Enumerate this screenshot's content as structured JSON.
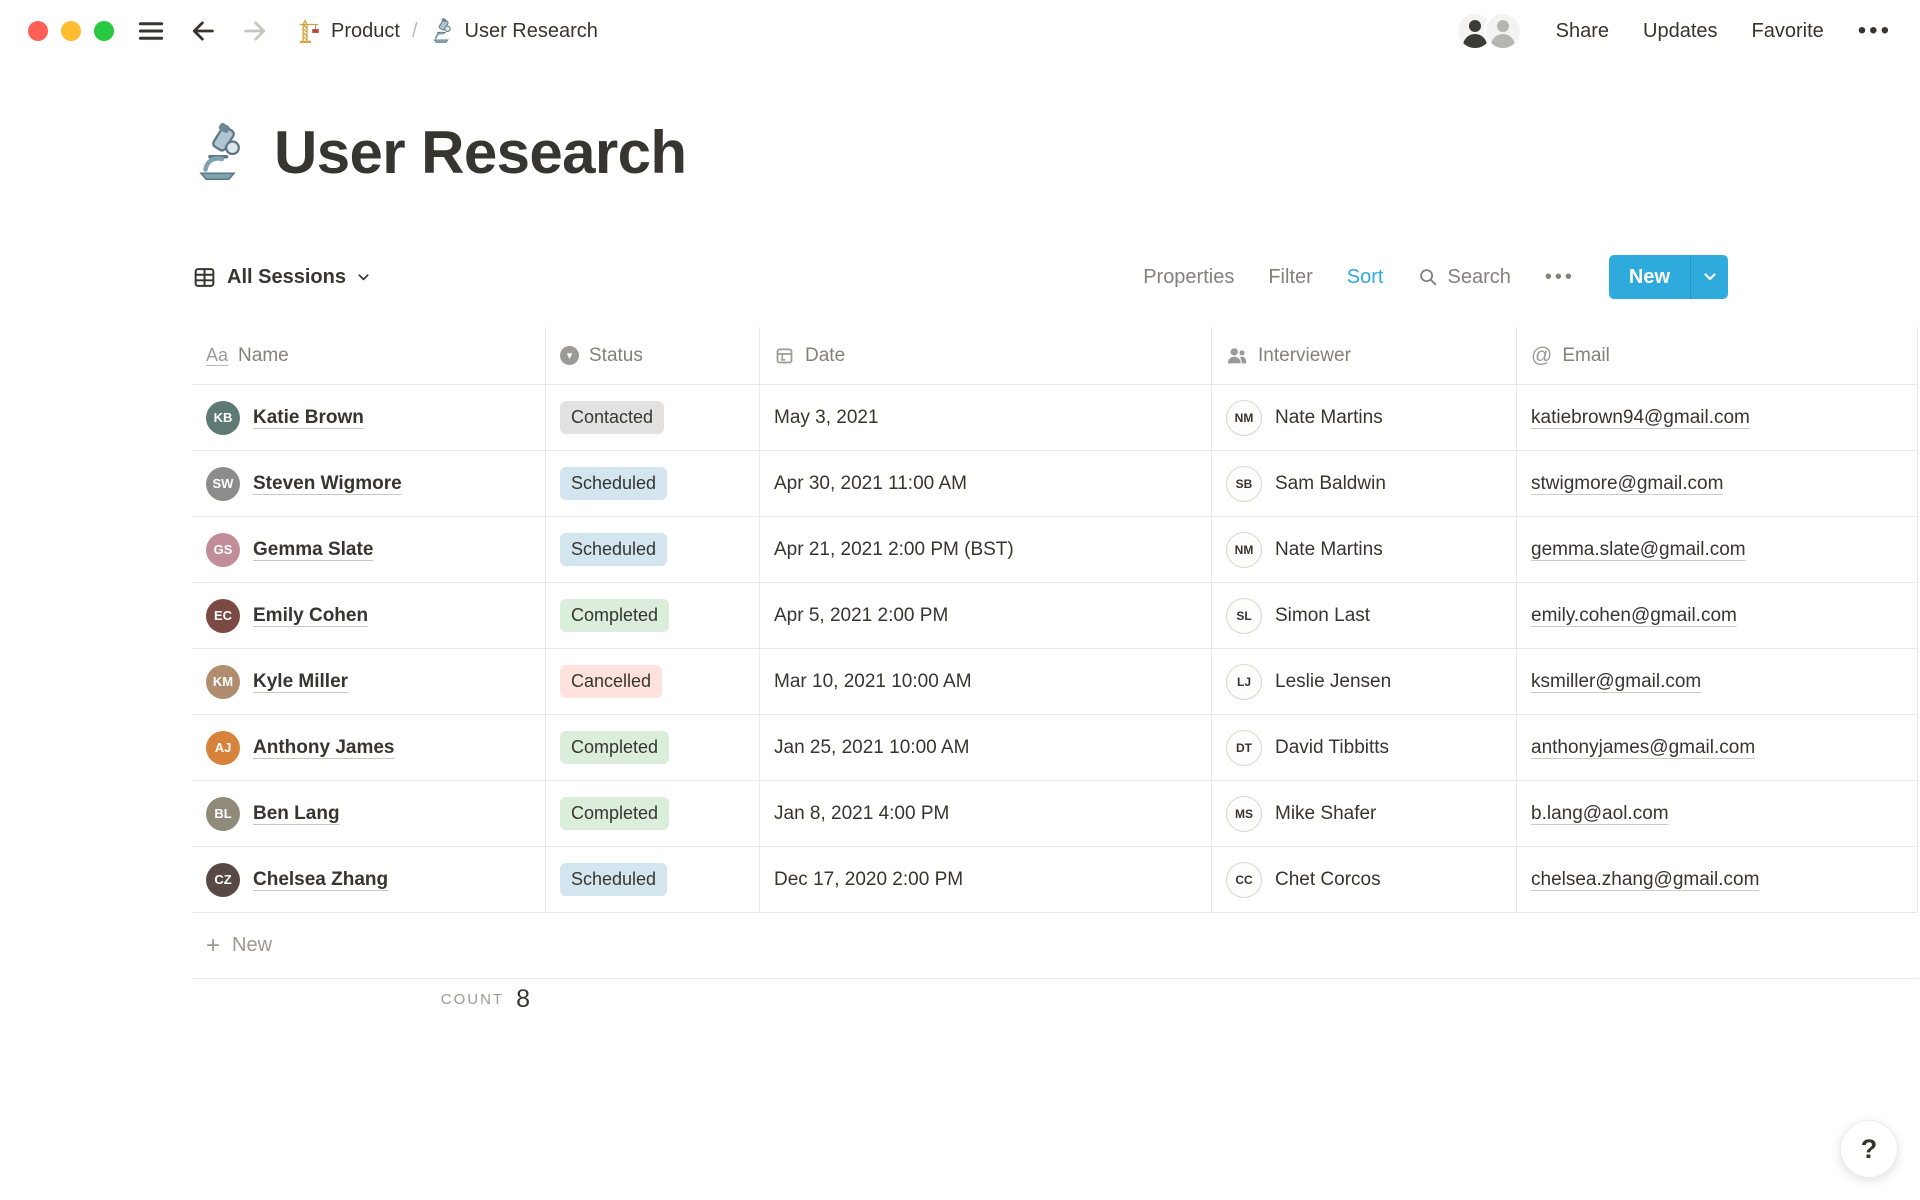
{
  "topbar": {
    "breadcrumb": {
      "root_icon": "building-construction-crane",
      "root_label": "Product",
      "separator": "/",
      "page_icon": "microscope",
      "page_label": "User Research"
    },
    "collaborators_count": 2,
    "share_label": "Share",
    "updates_label": "Updates",
    "favorite_label": "Favorite",
    "more_glyph": "•••"
  },
  "title": {
    "icon": "microscope",
    "text": "User Research"
  },
  "toolbar": {
    "view_label": "All Sessions",
    "properties_label": "Properties",
    "filter_label": "Filter",
    "sort_label": "Sort",
    "search_label": "Search",
    "more_glyph": "•••",
    "new_label": "New"
  },
  "table": {
    "columns": [
      {
        "key": "name",
        "label": "Name",
        "icon": "text"
      },
      {
        "key": "status",
        "label": "Status",
        "icon": "select"
      },
      {
        "key": "date",
        "label": "Date",
        "icon": "date"
      },
      {
        "key": "interviewer",
        "label": "Interviewer",
        "icon": "person"
      },
      {
        "key": "email",
        "label": "Email",
        "icon": "email"
      }
    ],
    "rows": [
      {
        "name": "Katie Brown",
        "initials": "KB",
        "avatar_color": "#5E7A74",
        "status": "Contacted",
        "status_key": "contacted",
        "date": "May 3, 2021",
        "interviewer": "Nate Martins",
        "interviewer_initials": "NM",
        "email": "katiebrown94@gmail.com"
      },
      {
        "name": "Steven Wigmore",
        "initials": "SW",
        "avatar_color": "#8C8C8A",
        "status": "Scheduled",
        "status_key": "scheduled",
        "date": "Apr 30, 2021 11:00 AM",
        "interviewer": "Sam Baldwin",
        "interviewer_initials": "SB",
        "email": "stwigmore@gmail.com"
      },
      {
        "name": "Gemma Slate",
        "initials": "GS",
        "avatar_color": "#C08D98",
        "status": "Scheduled",
        "status_key": "scheduled",
        "date": "Apr 21, 2021 2:00 PM (BST)",
        "interviewer": "Nate Martins",
        "interviewer_initials": "NM",
        "email": "gemma.slate@gmail.com"
      },
      {
        "name": "Emily Cohen",
        "initials": "EC",
        "avatar_color": "#7C4A45",
        "status": "Completed",
        "status_key": "completed",
        "date": "Apr 5, 2021 2:00 PM",
        "interviewer": "Simon Last",
        "interviewer_initials": "SL",
        "email": "emily.cohen@gmail.com"
      },
      {
        "name": "Kyle Miller",
        "initials": "KM",
        "avatar_color": "#B08D6E",
        "status": "Cancelled",
        "status_key": "cancelled",
        "date": "Mar 10, 2021 10:00 AM",
        "interviewer": "Leslie Jensen",
        "interviewer_initials": "LJ",
        "email": "ksmiller@gmail.com"
      },
      {
        "name": "Anthony James",
        "initials": "AJ",
        "avatar_color": "#D8833B",
        "status": "Completed",
        "status_key": "completed",
        "date": "Jan 25, 2021 10:00 AM",
        "interviewer": "David Tibbitts",
        "interviewer_initials": "DT",
        "email": "anthonyjames@gmail.com"
      },
      {
        "name": "Ben Lang",
        "initials": "BL",
        "avatar_color": "#8F8A79",
        "status": "Completed",
        "status_key": "completed",
        "date": "Jan 8, 2021 4:00 PM",
        "interviewer": "Mike Shafer",
        "interviewer_initials": "MS",
        "email": "b.lang@aol.com"
      },
      {
        "name": "Chelsea Zhang",
        "initials": "CZ",
        "avatar_color": "#574A44",
        "status": "Scheduled",
        "status_key": "scheduled",
        "date": "Dec 17, 2020 2:00 PM",
        "interviewer": "Chet Corcos",
        "interviewer_initials": "CC",
        "email": "chelsea.zhang@gmail.com"
      }
    ],
    "new_row_label": "New",
    "count_label": "COUNT",
    "count_value": "8"
  },
  "icons": {
    "text_glyph": "Aa",
    "email_glyph": "@",
    "select_glyph": "▾",
    "plus_glyph": "+",
    "help_glyph": "?"
  },
  "colors": {
    "accent_blue": "#2EAADC",
    "status": {
      "contacted": "#E3E2E0",
      "scheduled": "#D3E5EF",
      "completed": "#DBEDDB",
      "cancelled": "#FFE2DD"
    },
    "traffic": {
      "close": "#FF5F57",
      "minimize": "#FEBC2E",
      "zoom": "#28C840"
    }
  }
}
